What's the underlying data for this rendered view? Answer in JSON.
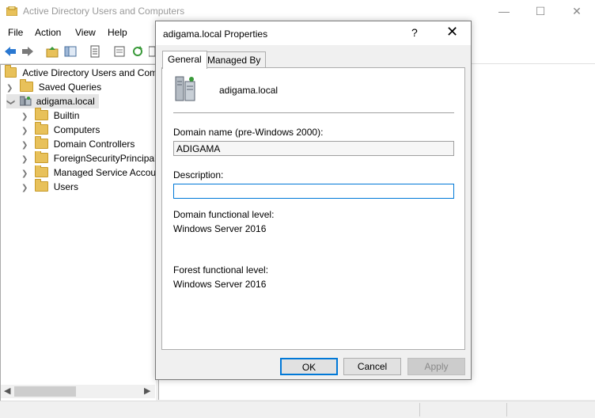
{
  "window": {
    "title": "Active Directory Users and Computers",
    "controls": [
      "—",
      "☐",
      "✕"
    ]
  },
  "menu": [
    "File",
    "Action",
    "View",
    "Help"
  ],
  "tree": {
    "root": "Active Directory Users and Com",
    "saved_queries": "Saved Queries",
    "domain": "adigama.local",
    "children": [
      "Builtin",
      "Computers",
      "Domain Controllers",
      "ForeignSecurityPrincipals",
      "Managed Service Accounts",
      "Users"
    ]
  },
  "dialog": {
    "title": "adigama.local Properties",
    "help": "?",
    "close": "✕",
    "tabs": [
      "General",
      "Managed By"
    ],
    "domain_display": "adigama.local",
    "domain_name_label": "Domain name (pre-Windows 2000):",
    "domain_name_value": "ADIGAMA",
    "description_label": "Description:",
    "description_value": "",
    "domain_level_label": "Domain functional level:",
    "domain_level_value": "Windows Server 2016",
    "forest_level_label": "Forest functional level:",
    "forest_level_value": "Windows Server 2016",
    "buttons": {
      "ok": "OK",
      "cancel": "Cancel",
      "apply": "Apply"
    }
  },
  "colors": {
    "accent": "#0078d7",
    "folder": "#e8c15a"
  }
}
